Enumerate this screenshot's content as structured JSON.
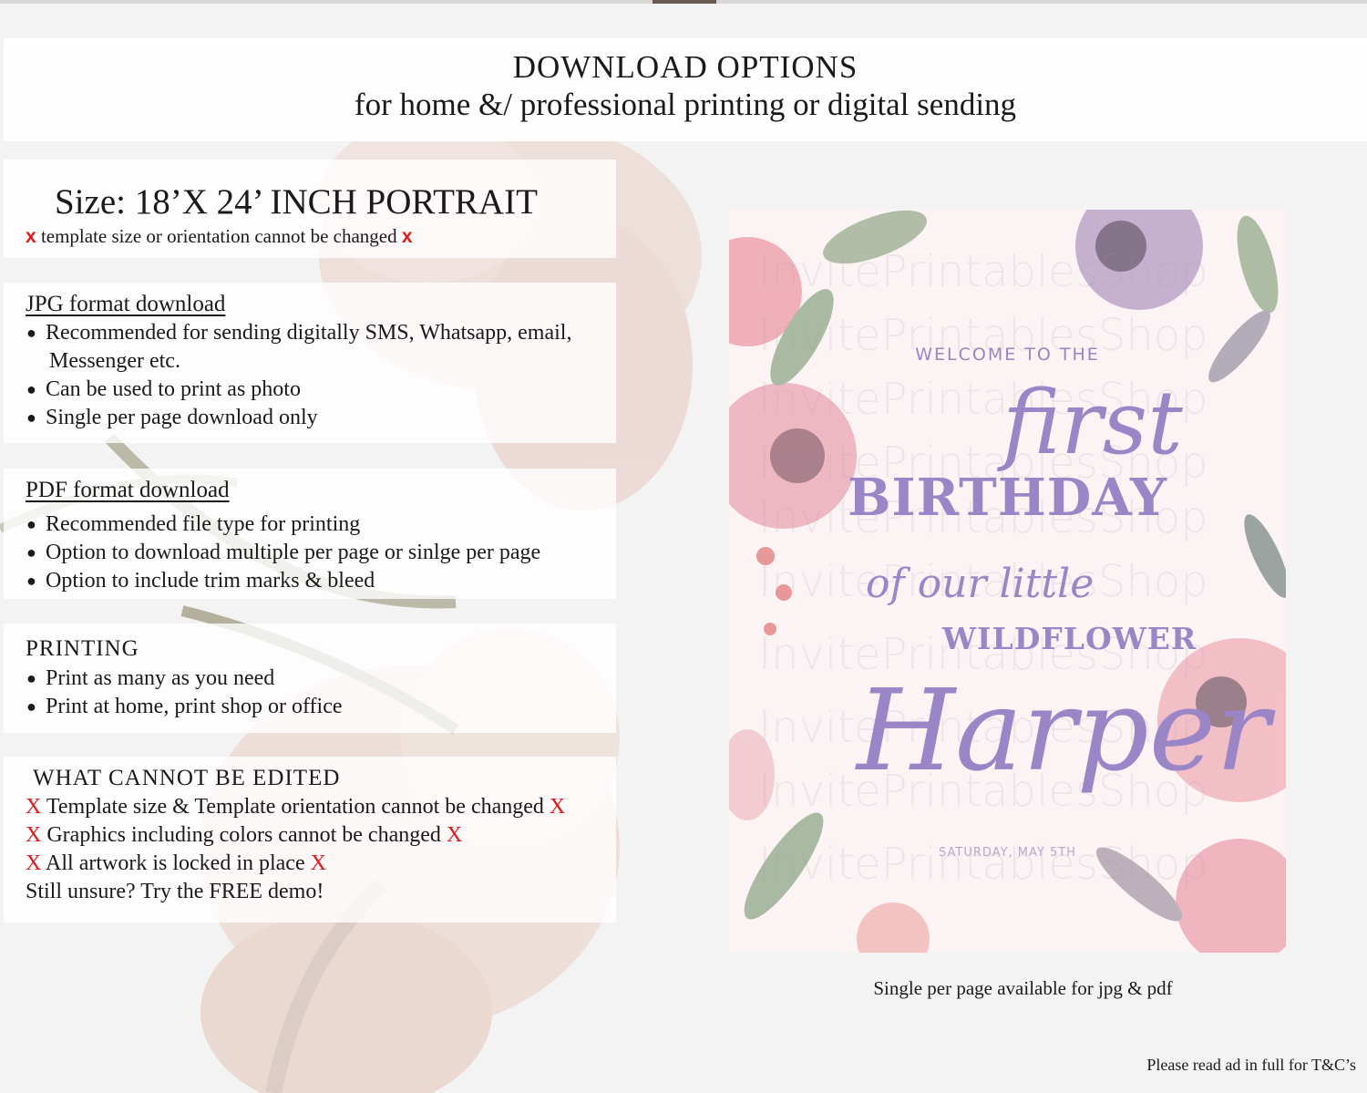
{
  "header": {
    "title": "DOWNLOAD OPTIONS",
    "subtitle": "for home &/ professional printing or digital sending"
  },
  "size": {
    "title": "Size: 18’X 24’ INCH PORTRAIT",
    "mark": "x",
    "note": "template size or orientation cannot be changed"
  },
  "jpg": {
    "title": "JPG format download",
    "bullets": [
      "Recommended for sending digitally SMS, Whatsapp, email,",
      "Can be used to print as photo",
      "Single per page download only"
    ],
    "bullet_continuation": "Messenger etc."
  },
  "pdf": {
    "title": "PDF format download",
    "bullets": [
      "Recommended file type for printing",
      "Option to download multiple per page or sinlge per page",
      "Option to include trim marks & bleed"
    ]
  },
  "printing": {
    "title": "PRINTING",
    "bullets": [
      "Print as many as you need",
      "Print at home, print shop or office"
    ]
  },
  "not_editable": {
    "title": "WHAT CANNOT BE EDITED",
    "mark": "X",
    "lines": [
      "Template size & Template orientation cannot be changed",
      "Graphics including colors cannot be changed",
      "All artwork is locked in place"
    ],
    "closing": "Still unsure? Try the FREE demo!"
  },
  "poster": {
    "watermark": "InvitePrintablesShop",
    "welcome": "WELCOME TO THE",
    "first": "first",
    "birthday": "BIRTHDAY",
    "of_our_little": "of our little",
    "wildflower": "WILDFLOWER",
    "name": "Harper",
    "date": "SATURDAY, MAY 5TH"
  },
  "caption": "Single per page available for jpg & pdf",
  "footer_note": "Please read ad in full for T&C’s",
  "colors": {
    "accent_red": "#e0191c",
    "poster_purple": "#9a86c7"
  }
}
